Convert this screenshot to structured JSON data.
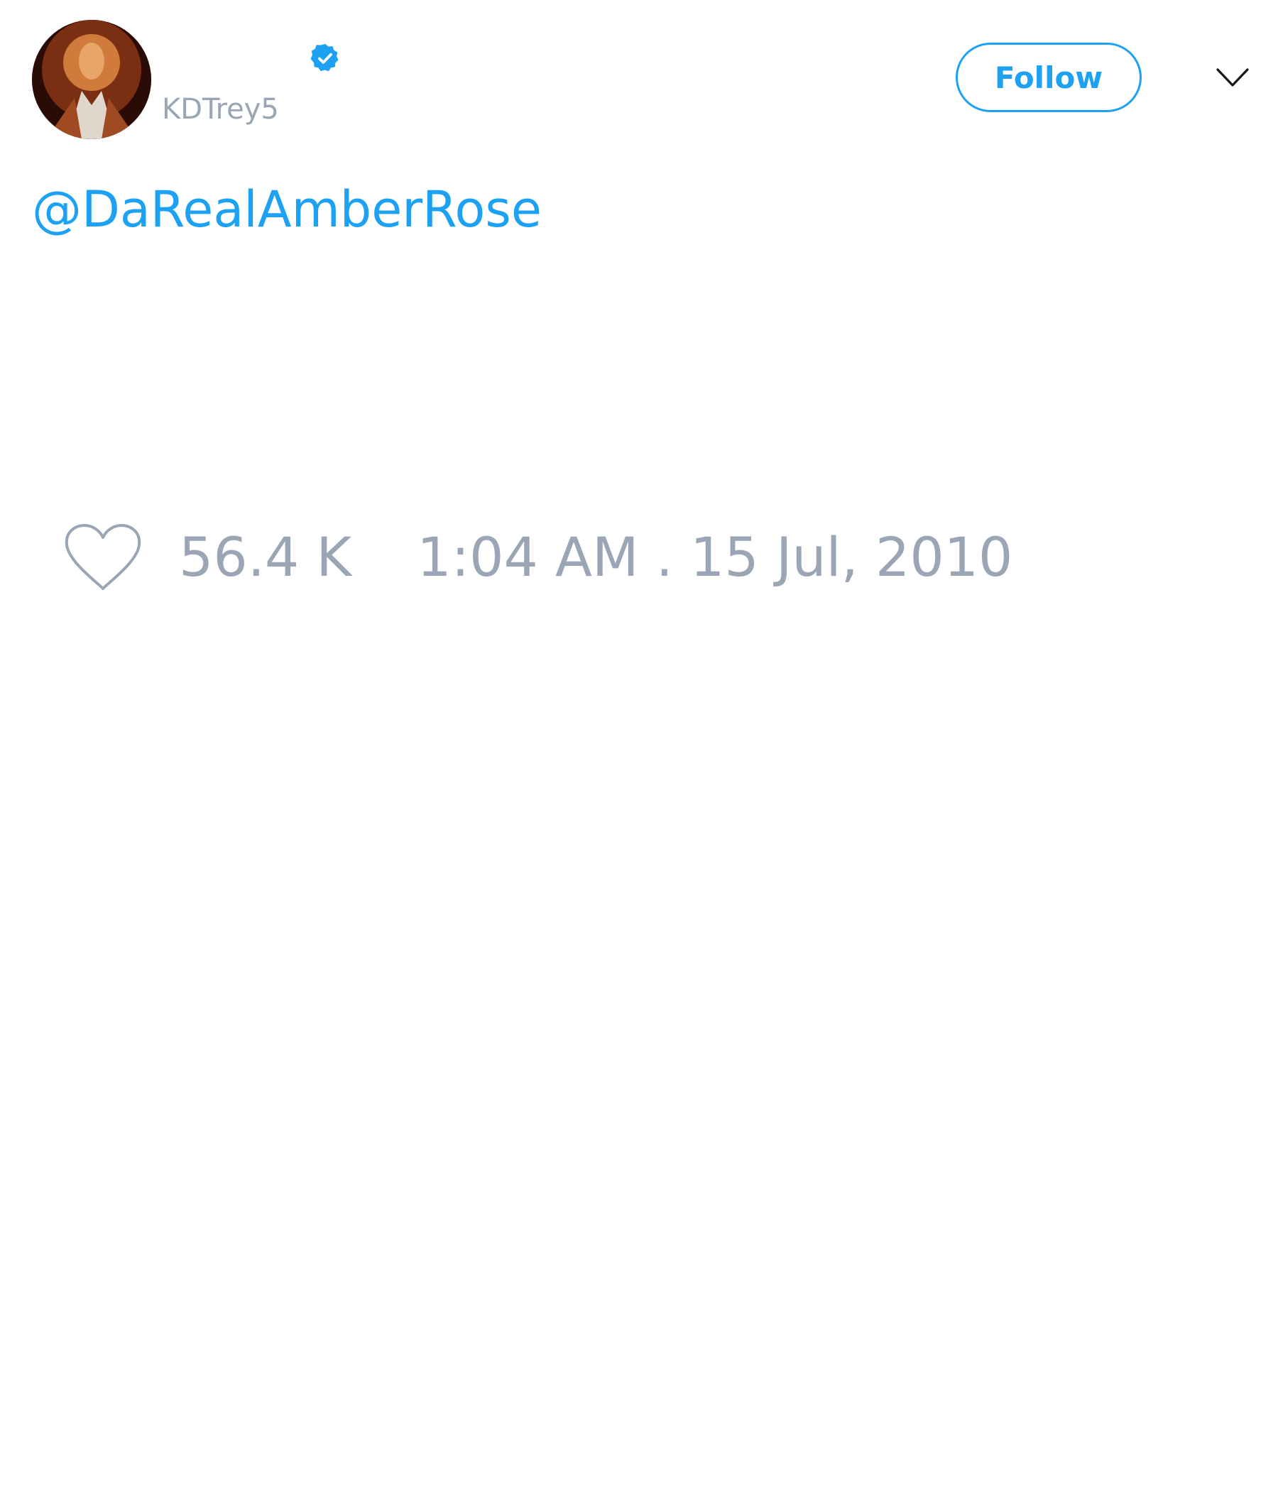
{
  "tweet": {
    "author": {
      "handle": "KDTrey5",
      "verified_icon": "verified-badge-icon",
      "avatar_icon": "avatar-photo"
    },
    "follow_label": "Follow",
    "menu_icon": "chevron-down-icon",
    "text": "@DaRealAmberRose",
    "likes": "56.4 K",
    "like_icon": "heart-icon",
    "timestamp": "1:04 AM . 15 Jul, 2010"
  },
  "colors": {
    "accent": "#1da1f2",
    "muted_text": "#9aa6b5",
    "background": "#ffffff"
  }
}
